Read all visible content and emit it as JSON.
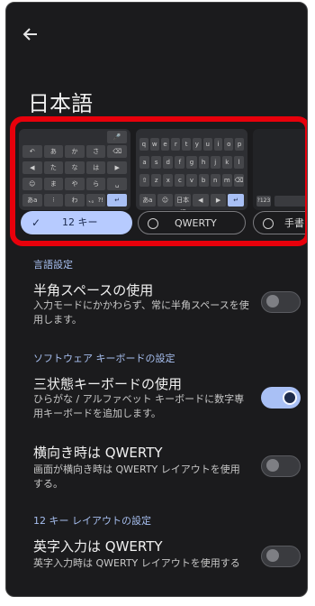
{
  "header": {
    "back_icon": "arrow-left-icon",
    "title": "日本語"
  },
  "layouts": {
    "twelve_key": {
      "rows": [
        [
          "",
          "",
          "",
          "",
          "🎤"
        ],
        [
          "↶",
          "あ",
          "か",
          "さ",
          "⌫"
        ],
        [
          "◀",
          "た",
          "な",
          "は",
          "▶"
        ],
        [
          "☺",
          "ま",
          "や",
          "ら",
          "␣"
        ],
        [
          "あa",
          "⁝",
          "わ",
          "、。?!",
          "↵"
        ]
      ]
    },
    "qwerty": {
      "rows": [
        [
          "q",
          "w",
          "e",
          "r",
          "t",
          "y",
          "u",
          "i",
          "o",
          "p"
        ],
        [
          "a",
          "s",
          "d",
          "f",
          "g",
          "h",
          "j",
          "k",
          "l"
        ],
        [
          "⇧",
          "z",
          "x",
          "c",
          "v",
          "b",
          "n",
          "m",
          "⌫"
        ],
        [
          "あa",
          "☺",
          "日本語",
          "◀",
          "▶",
          "↵"
        ]
      ]
    },
    "options": [
      {
        "label": "12 キー",
        "selected": true
      },
      {
        "label": "QWERTY",
        "selected": false
      },
      {
        "label": "手書",
        "selected": false
      }
    ],
    "partial_key": "?123"
  },
  "sections": {
    "language": {
      "header": "言語設定",
      "half_width_space": {
        "title": "半角スペースの使用",
        "desc": "入力モードにかかわらず、常に半角スペースを使用します。",
        "enabled": false
      }
    },
    "software_keyboard": {
      "header": "ソフトウェア キーボードの設定",
      "tristate": {
        "title": "三状態キーボードの使用",
        "desc": "ひらがな / アルファベット キーボードに数字専用キーボードを追加します。",
        "enabled": true
      },
      "landscape_qwerty": {
        "title": "横向き時は QWERTY",
        "desc": "画面が横向き時は QWERTY レイアウトを使用する。",
        "enabled": false
      }
    },
    "twelve_key_layout": {
      "header": "12 キー レイアウトの設定",
      "alpha_qwerty": {
        "title": "英字入力は QWERTY",
        "desc": "英字入力時は QWERTY レイアウトを使用する",
        "enabled": false
      }
    }
  },
  "colors": {
    "highlight": "#e8000b",
    "accent": "#a9c0f5",
    "background": "#1b1b1d"
  }
}
